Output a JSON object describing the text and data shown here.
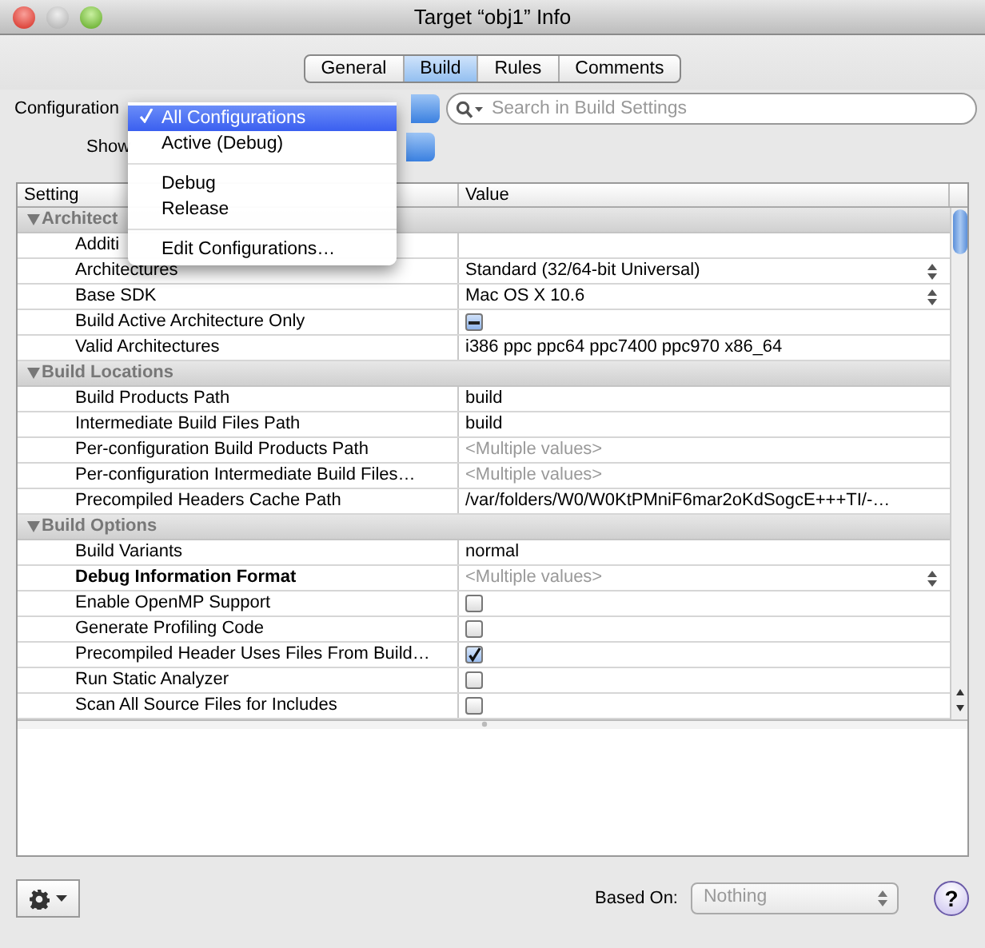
{
  "window": {
    "title": "Target “obj1” Info"
  },
  "tabs": [
    {
      "label": "General",
      "selected": false
    },
    {
      "label": "Build",
      "selected": true
    },
    {
      "label": "Rules",
      "selected": false
    },
    {
      "label": "Comments",
      "selected": false
    }
  ],
  "configuration_label": "Configuration",
  "show_label": "Show",
  "search": {
    "placeholder": "Search in Build Settings"
  },
  "configuration_menu": [
    {
      "kind": "item",
      "label": "All Configurations",
      "selected": true
    },
    {
      "kind": "item",
      "label": "Active (Debug)",
      "selected": false
    },
    {
      "kind": "separator"
    },
    {
      "kind": "item",
      "label": "Debug",
      "selected": false
    },
    {
      "kind": "item",
      "label": "Release",
      "selected": false
    },
    {
      "kind": "separator"
    },
    {
      "kind": "item",
      "label": "Edit Configurations…",
      "selected": false
    }
  ],
  "table": {
    "columns": [
      "Setting",
      "Value"
    ],
    "sections": [
      {
        "title": "Architect",
        "expanded": true,
        "rows": [
          {
            "name": "Additi",
            "bold": false,
            "kind": "text",
            "value": ""
          },
          {
            "name": "Architectures",
            "bold": false,
            "kind": "popup",
            "value": "Standard (32/64-bit Universal)"
          },
          {
            "name": "Base SDK",
            "bold": false,
            "kind": "popup",
            "value": "Mac OS X 10.6"
          },
          {
            "name": "Build Active Architecture Only",
            "bold": false,
            "kind": "checkbox",
            "mixed": true
          },
          {
            "name": "Valid Architectures",
            "bold": false,
            "kind": "text",
            "value": "i386 ppc ppc64 ppc7400 ppc970 x86_64"
          }
        ]
      },
      {
        "title": "Build Locations",
        "expanded": true,
        "rows": [
          {
            "name": "Build Products Path",
            "bold": false,
            "kind": "text",
            "value": "build"
          },
          {
            "name": "Intermediate Build Files Path",
            "bold": false,
            "kind": "text",
            "value": "build"
          },
          {
            "name": "Per-configuration Build Products Path",
            "bold": false,
            "kind": "multiple",
            "value": "<Multiple values>"
          },
          {
            "name": "Per-configuration Intermediate Build Files…",
            "bold": false,
            "kind": "multiple",
            "value": "<Multiple values>"
          },
          {
            "name": "Precompiled Headers Cache Path",
            "bold": false,
            "kind": "text",
            "value": "/var/folders/W0/W0KtPMniF6mar2oKdSogcE+++TI/-…"
          }
        ]
      },
      {
        "title": "Build Options",
        "expanded": true,
        "rows": [
          {
            "name": "Build Variants",
            "bold": false,
            "kind": "text",
            "value": "normal"
          },
          {
            "name": "Debug Information Format",
            "bold": true,
            "kind": "multiple-popup",
            "value": "<Multiple values>"
          },
          {
            "name": "Enable OpenMP Support",
            "bold": false,
            "kind": "checkbox",
            "checked": false,
            "mixed": false
          },
          {
            "name": "Generate Profiling Code",
            "bold": false,
            "kind": "checkbox",
            "checked": false,
            "mixed": false
          },
          {
            "name": "Precompiled Header Uses Files From Build…",
            "bold": false,
            "kind": "checkbox",
            "checked": true,
            "mixed": false
          },
          {
            "name": "Run Static Analyzer",
            "bold": false,
            "kind": "checkbox",
            "checked": false,
            "mixed": false
          },
          {
            "name": "Scan All Source Files for Includes",
            "bold": false,
            "kind": "checkbox",
            "checked": false,
            "mixed": false
          }
        ]
      }
    ]
  },
  "footer": {
    "based_on_label": "Based On:",
    "based_on": {
      "value": "Nothing",
      "disabled": true
    },
    "help": "?"
  }
}
